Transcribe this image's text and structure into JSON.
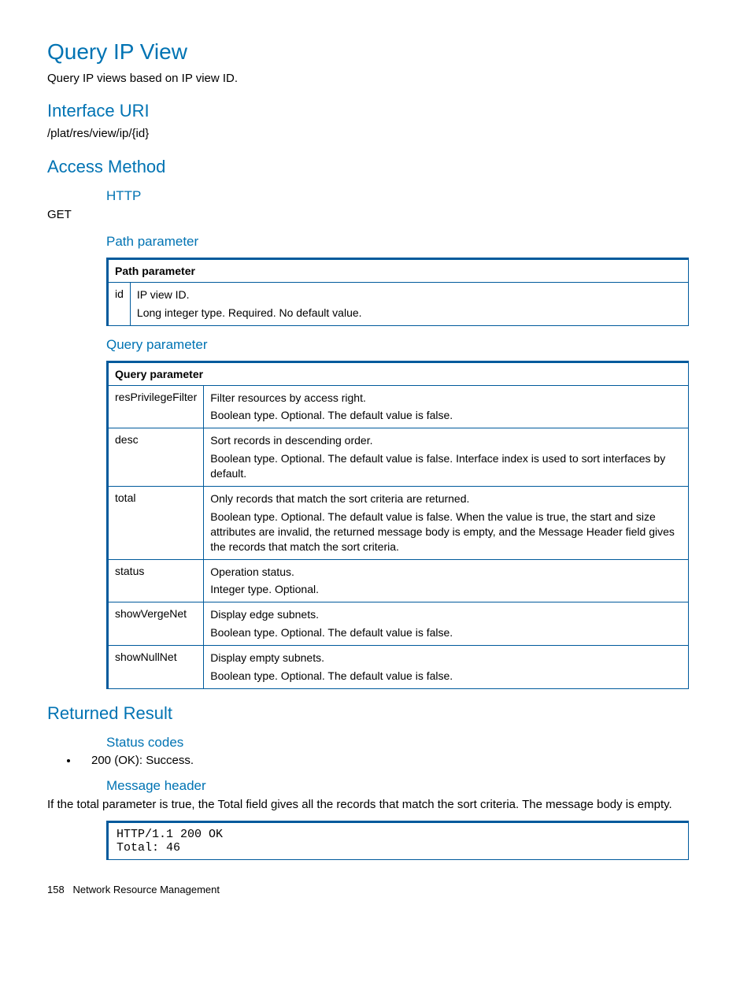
{
  "title": "Query IP View",
  "intro": "Query IP views based on IP view ID.",
  "interface_uri": {
    "heading": "Interface URI",
    "value": "/plat/res/view/ip/{id}"
  },
  "access_method": {
    "heading": "Access Method",
    "http_heading": "HTTP",
    "http_value": "GET",
    "path_heading": "Path parameter",
    "path_table_header": "Path parameter",
    "path_rows": [
      {
        "name": "id",
        "line1": "IP view ID.",
        "line2": "Long integer type. Required. No default value."
      }
    ],
    "query_heading": "Query parameter",
    "query_table_header": "Query parameter",
    "query_rows": [
      {
        "name": "resPrivilegeFilter",
        "line1": "Filter resources by access right.",
        "line2": "Boolean type. Optional. The default value is false."
      },
      {
        "name": "desc",
        "line1": "Sort records in descending order.",
        "line2": "Boolean type. Optional. The default value is false. Interface index is used to sort interfaces by default."
      },
      {
        "name": "total",
        "line1": "Only records that match the sort criteria are returned.",
        "line2": "Boolean type. Optional. The default value is false. When the value is true, the start and size attributes are invalid, the returned message body is empty, and the Message Header field gives the records that match the sort criteria."
      },
      {
        "name": "status",
        "line1": "Operation status.",
        "line2": "Integer type. Optional."
      },
      {
        "name": "showVergeNet",
        "line1": "Display edge subnets.",
        "line2": "Boolean type. Optional. The default value is false."
      },
      {
        "name": "showNullNet",
        "line1": "Display empty subnets.",
        "line2": "Boolean type. Optional. The default value is false."
      }
    ]
  },
  "returned": {
    "heading": "Returned Result",
    "status_heading": "Status codes",
    "status_bullet": "200 (OK): Success.",
    "msg_heading": "Message header",
    "msg_body": "If the total parameter is true, the Total field gives all the records that match the sort criteria. The message body is empty.",
    "code": "HTTP/1.1 200 OK\nTotal: 46"
  },
  "footer": {
    "page": "158",
    "section": "Network Resource Management"
  }
}
